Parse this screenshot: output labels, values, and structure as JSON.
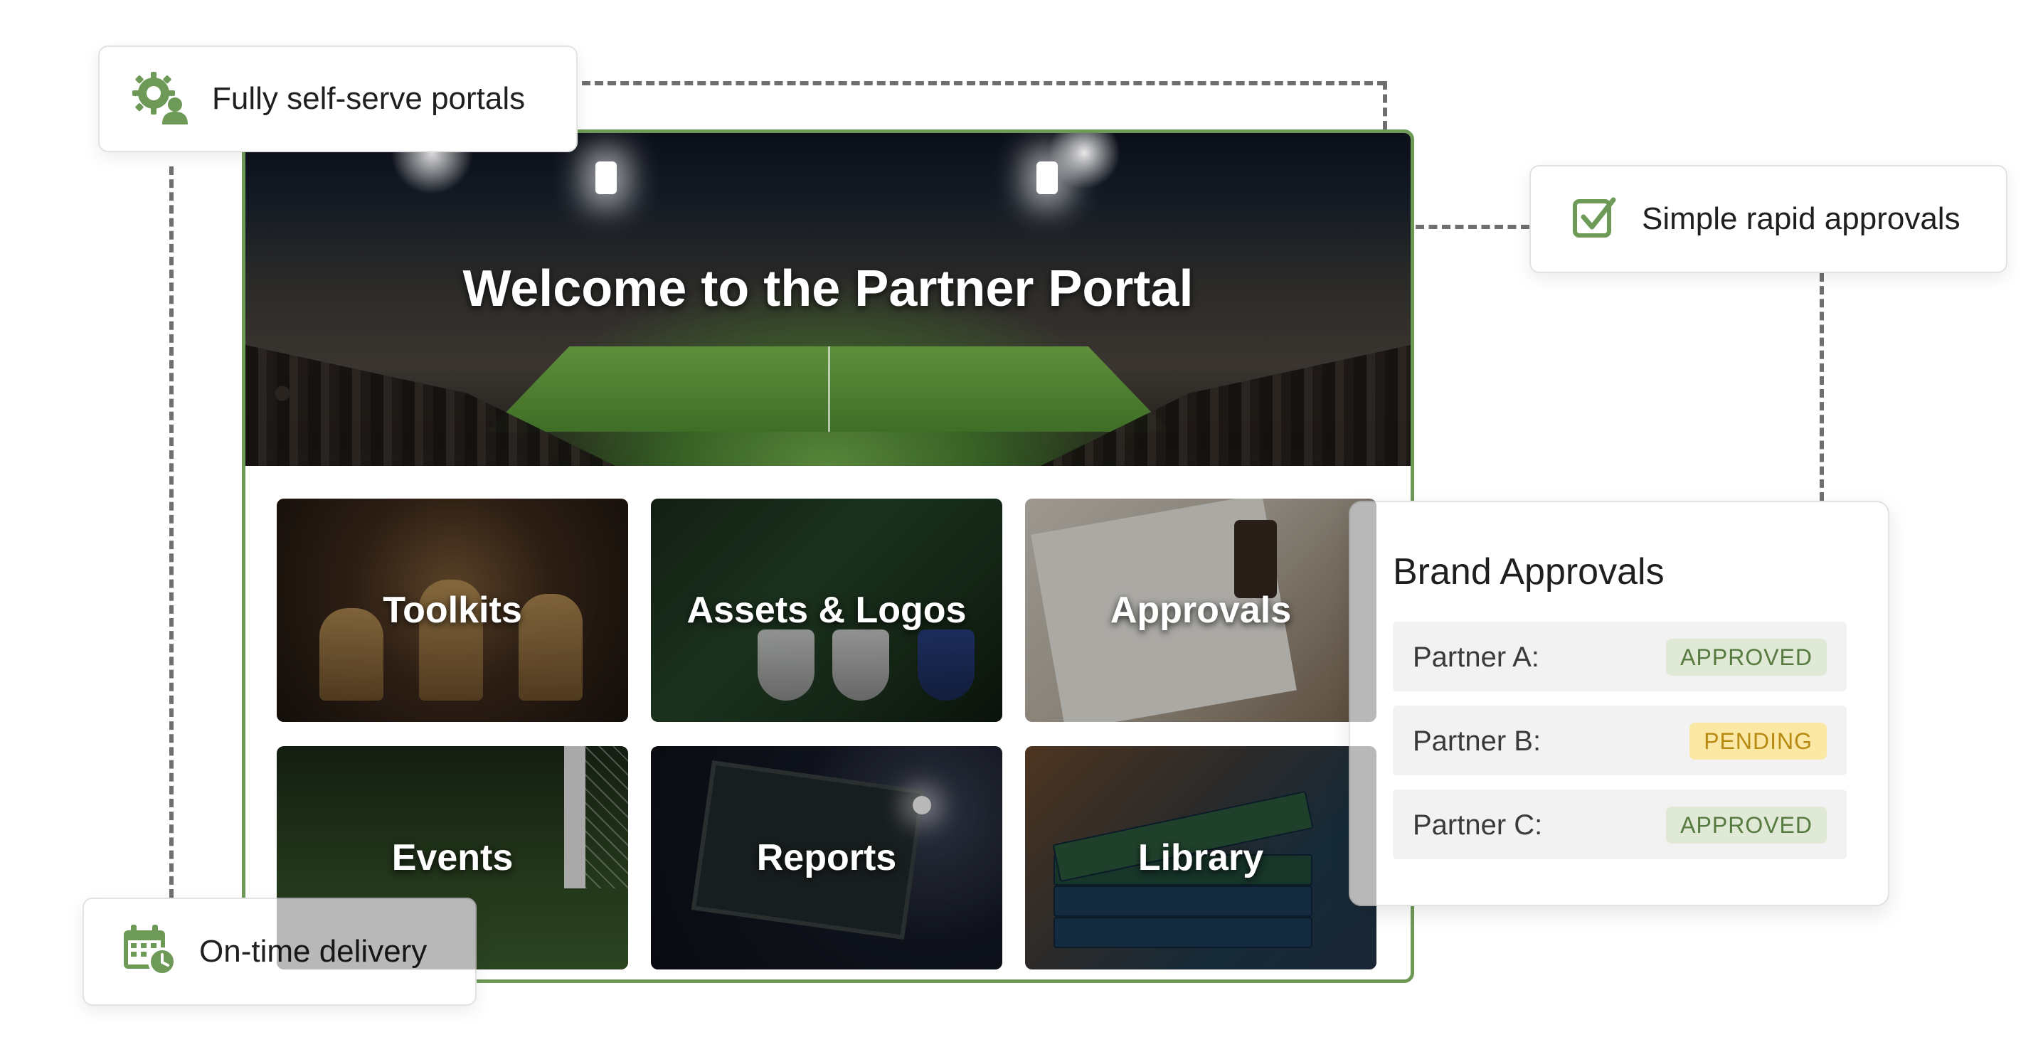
{
  "hero": {
    "title": "Welcome to the Partner Portal"
  },
  "tiles": [
    {
      "label": "Toolkits"
    },
    {
      "label": "Assets & Logos"
    },
    {
      "label": "Approvals"
    },
    {
      "label": "Events"
    },
    {
      "label": "Reports"
    },
    {
      "label": "Library"
    }
  ],
  "callouts": {
    "self_serve": {
      "label": "Fully self-serve portals",
      "icon": "gear-user-icon"
    },
    "rapid": {
      "label": "Simple rapid approvals",
      "icon": "checkbox-icon"
    },
    "delivery": {
      "label": "On-time delivery",
      "icon": "calendar-clock-icon"
    }
  },
  "brand_approvals": {
    "title": "Brand Approvals",
    "rows": [
      {
        "label": "Partner A:",
        "status": "APPROVED"
      },
      {
        "label": "Partner B:",
        "status": "PENDING"
      },
      {
        "label": "Partner C:",
        "status": "APPROVED"
      }
    ]
  },
  "colors": {
    "accent": "#6e9a58",
    "approved_bg": "#dfe9d6",
    "approved_text": "#567a3f",
    "pending_bg": "#fbe8a4",
    "pending_text": "#b78a12"
  }
}
